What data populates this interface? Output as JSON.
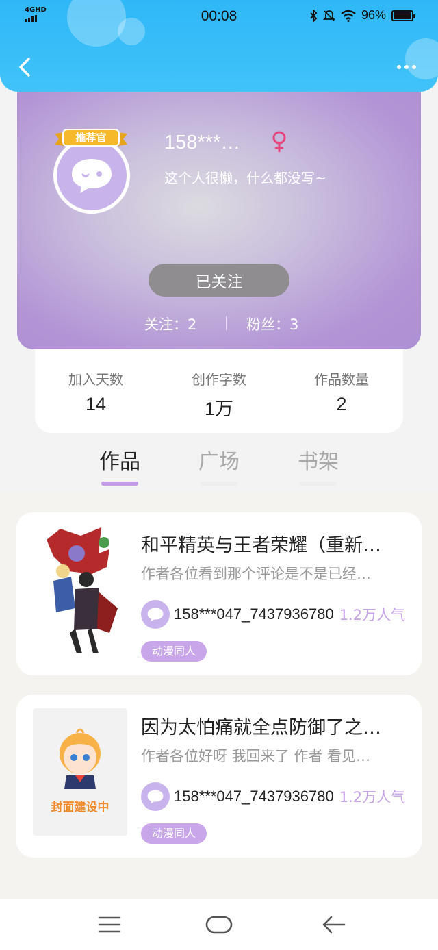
{
  "status_bar": {
    "network": "4GHD",
    "time": "00:08",
    "battery": "96%",
    "battery_level": 0.96
  },
  "header": {
    "back_icon": "chevron-left-icon",
    "more_icon": "more-dots-icon"
  },
  "profile": {
    "badge": "推荐官",
    "username": "158***…",
    "gender": "female",
    "bio": "这个人很懒，什么都没写~",
    "follow_button": "已关注",
    "following": "关注：2",
    "followers": "粉丝：3"
  },
  "stats": [
    {
      "label": "加入天数",
      "value": "14"
    },
    {
      "label": "创作字数",
      "value": "1万"
    },
    {
      "label": "作品数量",
      "value": "2"
    }
  ],
  "tabs": [
    {
      "label": "作品",
      "active": true
    },
    {
      "label": "广场",
      "active": false
    },
    {
      "label": "书架",
      "active": false
    }
  ],
  "works": [
    {
      "title": "和平精英与王者荣耀（重新…",
      "description": "作者各位看到那个评论是不是已经…",
      "author": "158***047_7437936780",
      "popularity": "1.2万人气",
      "tag": "动漫同人"
    },
    {
      "title": "因为太怕痛就全点防御了之…",
      "description": "作者各位好呀 我回来了 作者 看见…",
      "author": "158***047_7437936780",
      "popularity": "1.2万人气",
      "tag": "动漫同人",
      "cover_text": "封面建设中"
    }
  ],
  "colors": {
    "header": "#2fb7f7",
    "accent": "#c39be6",
    "tag": "#c9a6ea",
    "popularity": "#c6a2e6"
  }
}
